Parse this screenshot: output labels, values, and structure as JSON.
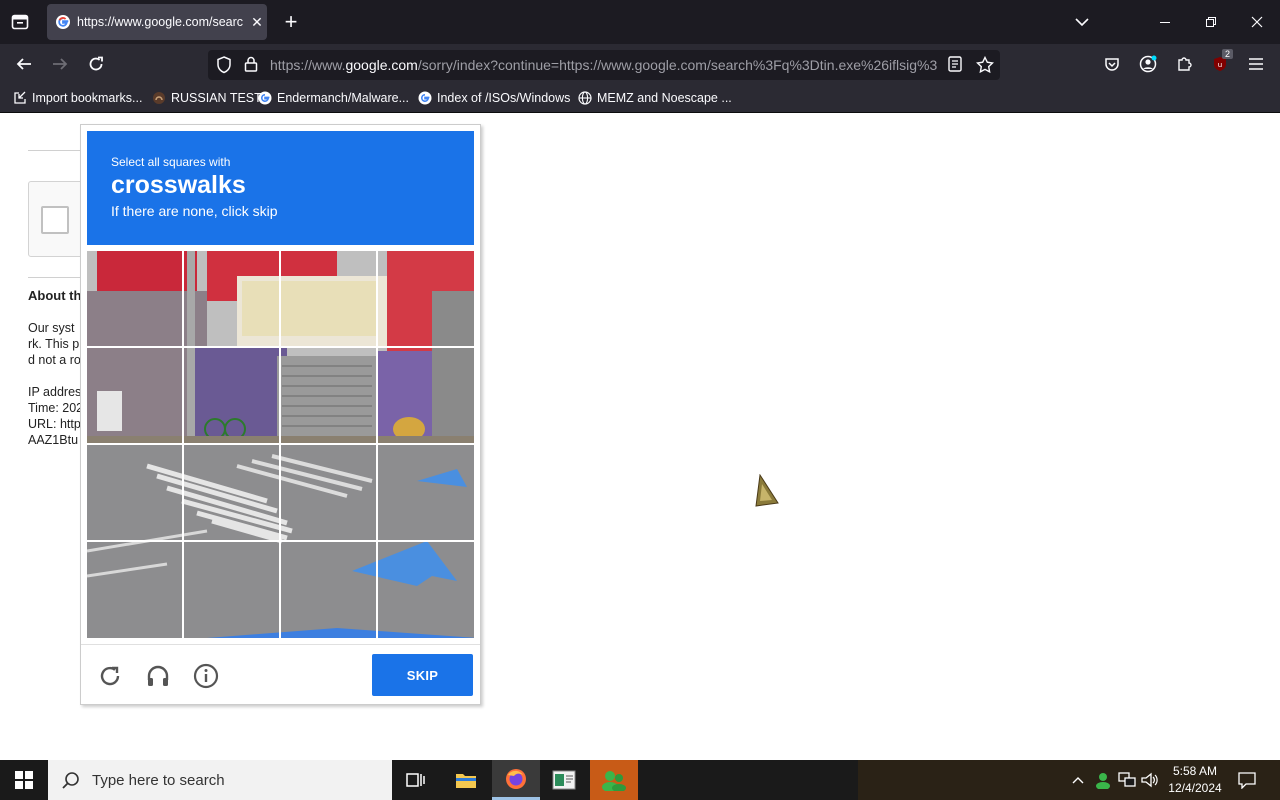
{
  "browser": {
    "tab_title": "https://www.google.com/searc",
    "url_prefix": "https://www.",
    "url_host": "google.com",
    "url_rest": "/sorry/index?continue=https://www.google.com/search%3Fq%3Dtin.exe%26iflsig%3D",
    "extension_badge": "2",
    "bookmarks": [
      {
        "label": "Import bookmarks...",
        "icon": "import-icon"
      },
      {
        "label": "RUSSIAN TEST",
        "icon": "site-icon"
      },
      {
        "label": "Endermanch/Malware...",
        "icon": "google-icon"
      },
      {
        "label": "Index of /ISOs/Windows",
        "icon": "google-icon"
      },
      {
        "label": "MEMZ and Noescape ...",
        "icon": "globe-icon"
      }
    ]
  },
  "page": {
    "about_title": "About th",
    "about_lines": [
      "Our syst",
      "rk. This p",
      "d not a ro",
      "",
      "IP addres",
      "Time: 202",
      "URL: http",
      "AAZ1Btu"
    ]
  },
  "captcha": {
    "instruction_small": "Select all squares with",
    "target": "crosswalks",
    "instruction_sub": "If there are none, click skip",
    "skip_label": "SKIP",
    "accent_color": "#1a73e8"
  },
  "taskbar": {
    "search_placeholder": "Type here to search",
    "time": "5:58 AM",
    "date": "12/4/2024"
  }
}
